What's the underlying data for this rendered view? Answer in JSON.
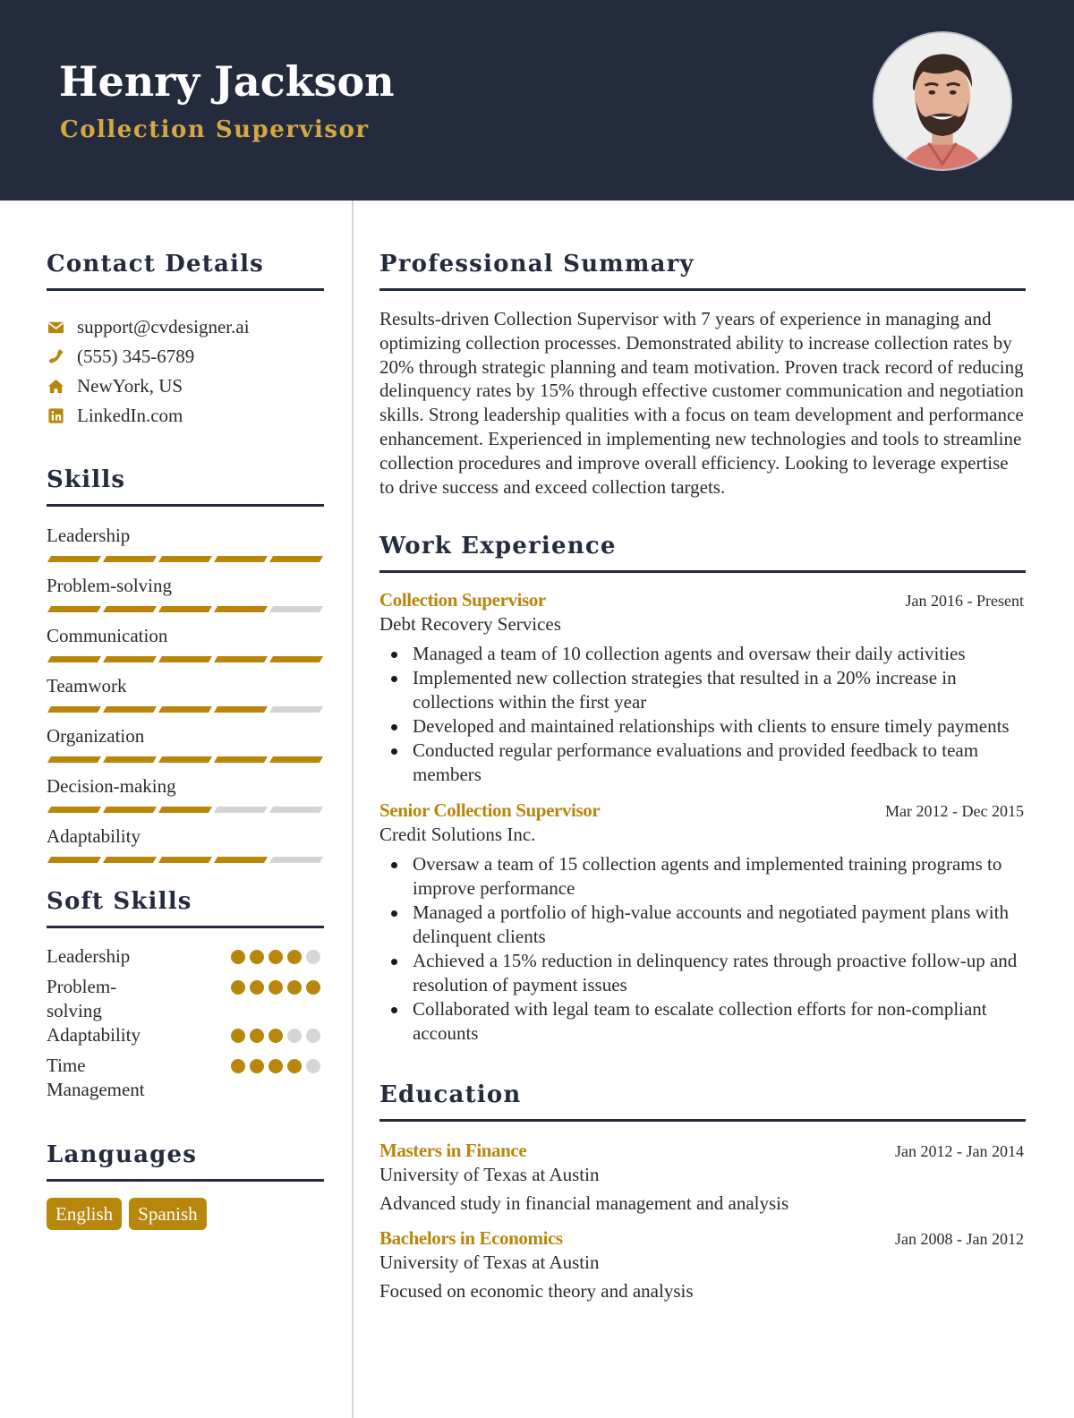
{
  "header": {
    "name": "Henry Jackson",
    "title": "Collection Supervisor",
    "photo_alt": "Profile photo of Henry Jackson"
  },
  "colors": {
    "header_bg": "#232b3d",
    "accent": "#b8860b",
    "title_gold": "#d4a843",
    "inactive": "#d3d3d3"
  },
  "contact": {
    "heading": "Contact Details",
    "items": [
      {
        "icon": "envelope-icon",
        "text": "support@cvdesigner.ai"
      },
      {
        "icon": "phone-icon",
        "text": "(555) 345-6789"
      },
      {
        "icon": "home-icon",
        "text": "NewYork, US"
      },
      {
        "icon": "linkedin-icon",
        "text": "LinkedIn.com"
      }
    ]
  },
  "skills": {
    "heading": "Skills",
    "max": 5,
    "items": [
      {
        "label": "Leadership",
        "level": 5
      },
      {
        "label": "Problem-solving",
        "level": 4
      },
      {
        "label": "Communication",
        "level": 5
      },
      {
        "label": "Teamwork",
        "level": 4
      },
      {
        "label": "Organization",
        "level": 5
      },
      {
        "label": "Decision-making",
        "level": 3
      },
      {
        "label": "Adaptability",
        "level": 4
      }
    ]
  },
  "soft_skills": {
    "heading": "Soft Skills",
    "max": 5,
    "items": [
      {
        "label": "Leadership",
        "level": 4
      },
      {
        "label": "Problem-solving",
        "level": 5
      },
      {
        "label": "Adaptability",
        "level": 3
      },
      {
        "label": "Time Management",
        "level": 4
      }
    ]
  },
  "languages": {
    "heading": "Languages",
    "items": [
      "English",
      "Spanish"
    ]
  },
  "summary": {
    "heading": "Professional Summary",
    "text": "Results-driven Collection Supervisor with 7 years of experience in managing and optimizing collection processes. Demonstrated ability to increase collection rates by 20% through strategic planning and team motivation. Proven track record of reducing delinquency rates by 15% through effective customer communication and negotiation skills. Strong leadership qualities with a focus on team development and performance enhancement. Experienced in implementing new technologies and tools to streamline collection procedures and improve overall efficiency. Looking to leverage expertise to drive success and exceed collection targets."
  },
  "experience": {
    "heading": "Work Experience",
    "items": [
      {
        "title": "Collection Supervisor",
        "company": "Debt Recovery Services",
        "dates": "Jan 2016 - Present",
        "bullets": [
          "Managed a team of 10 collection agents and oversaw their daily activities",
          "Implemented new collection strategies that resulted in a 20% increase in collections within the first year",
          "Developed and maintained relationships with clients to ensure timely payments",
          "Conducted regular performance evaluations and provided feedback to team members"
        ]
      },
      {
        "title": "Senior Collection Supervisor",
        "company": "Credit Solutions Inc.",
        "dates": "Mar 2012 - Dec 2015",
        "bullets": [
          "Oversaw a team of 15 collection agents and implemented training programs to improve performance",
          "Managed a portfolio of high-value accounts and negotiated payment plans with delinquent clients",
          "Achieved a 15% reduction in delinquency rates through proactive follow-up and resolution of payment issues",
          "Collaborated with legal team to escalate collection efforts for non-compliant accounts"
        ]
      }
    ]
  },
  "education": {
    "heading": "Education",
    "items": [
      {
        "degree": "Masters in Finance",
        "school": "University of Texas at Austin",
        "dates": "Jan 2012 - Jan 2014",
        "description": "Advanced study in financial management and analysis"
      },
      {
        "degree": "Bachelors in Economics",
        "school": "University of Texas at Austin",
        "dates": "Jan 2008 - Jan 2012",
        "description": "Focused on economic theory and analysis"
      }
    ]
  }
}
